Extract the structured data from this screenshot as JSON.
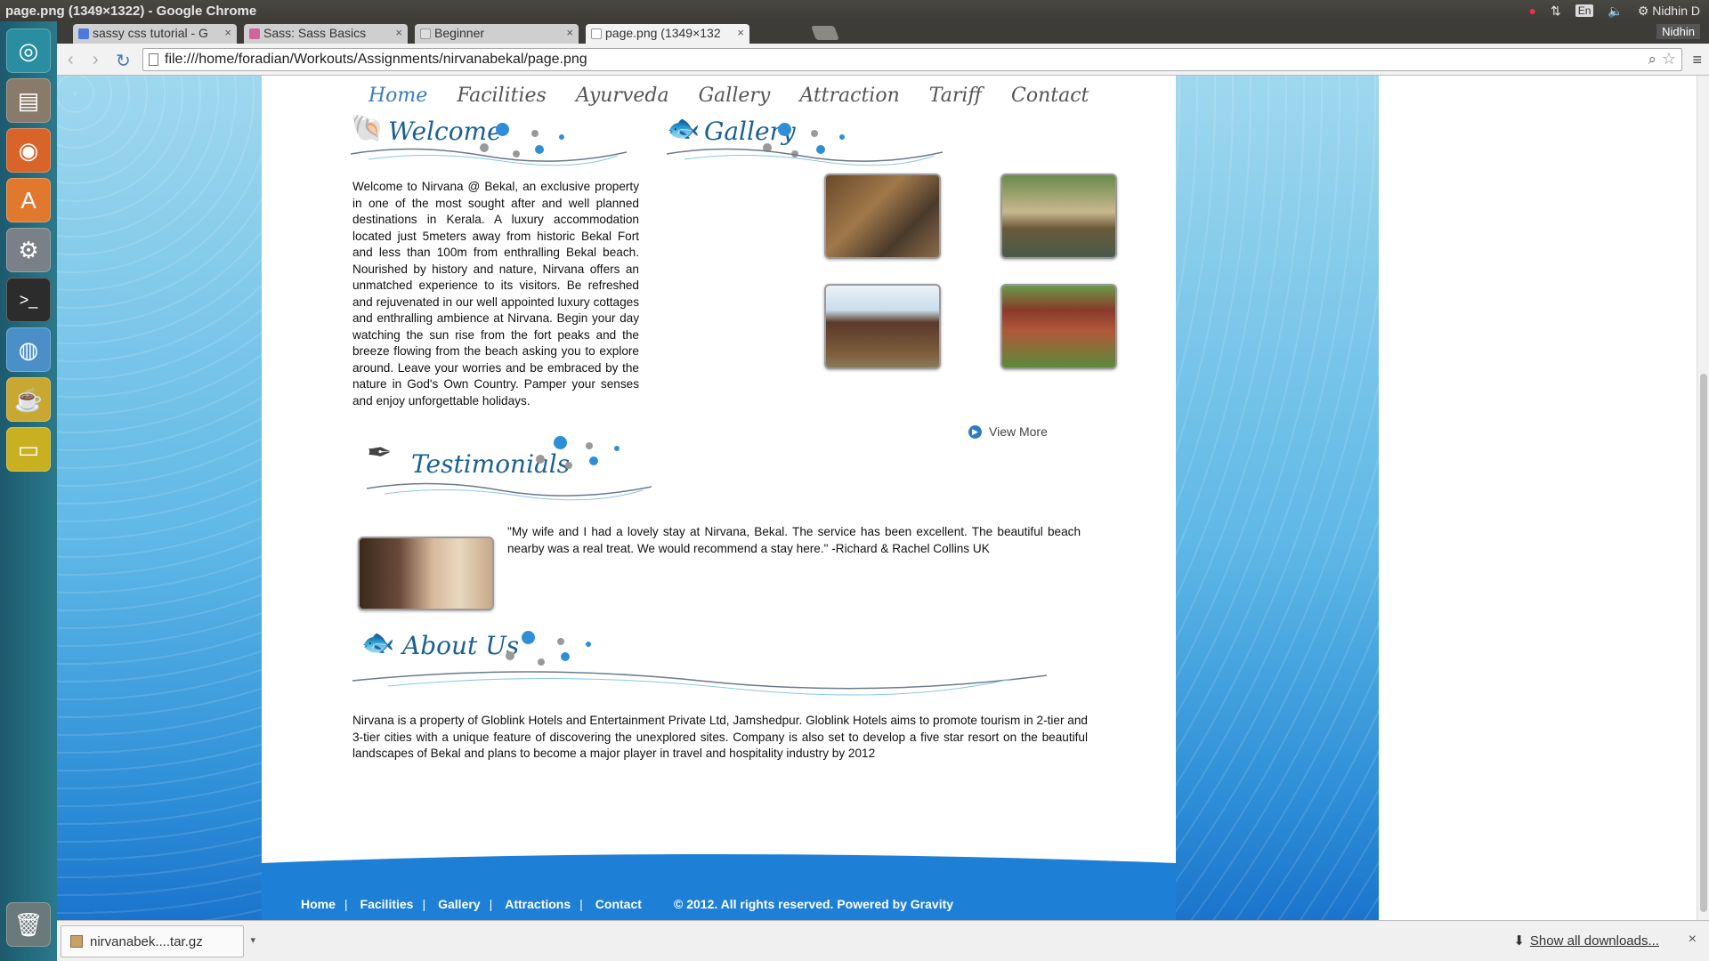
{
  "os": {
    "window_title": "page.png (1349×1322) - Google Chrome",
    "lang": "En",
    "user": "Nidhin D"
  },
  "chrome": {
    "tabs": [
      {
        "label": "sassy css tutorial - G",
        "icon": "google-icon"
      },
      {
        "label": "Sass: Sass Basics",
        "icon": "sass-icon"
      },
      {
        "label": "Beginner",
        "icon": "page-icon"
      },
      {
        "label": "page.png (1349×132",
        "icon": "page-icon"
      }
    ],
    "profile": "Nidhin",
    "url": "file:///home/foradian/Workouts/Assignments/nirvanabekal/page.png"
  },
  "site": {
    "nav": [
      "Home",
      "Facilities",
      "Ayurveda",
      "Gallery",
      "Attraction",
      "Tariff",
      "Contact"
    ],
    "welcome": {
      "title": "Welcome",
      "body": "Welcome to Nirvana @ Bekal, an exclusive property in one of the most sought after and well planned destinations in Kerala. A luxury accommodation located just 5meters away from historic Bekal Fort and less than 100m from enthralling Bekal beach. Nourished by history and nature, Nirvana offers an unmatched experience to its visitors. Be refreshed and rejuvenated in our well appointed luxury cottages and enthralling ambience at Nirvana. Begin your day watching the sun rise from the fort peaks and the breeze flowing from the beach asking you to explore around. Leave your worries and be embraced by the nature in God's Own Country. Pamper your senses and enjoy unforgettable holidays."
    },
    "gallery": {
      "title": "Gallery",
      "view_more": "View More"
    },
    "testimonials": {
      "title": "Testimonials",
      "quote": "\"My wife and I had a lovely stay at Nirvana, Bekal. The service has been excellent. The beautiful beach nearby was a real treat. We would recommend a stay here.\" -Richard & Rachel Collins UK"
    },
    "about": {
      "title": "About Us",
      "body": "Nirvana is a property of Globlink Hotels and Entertainment Private Ltd, Jamshedpur. Globlink Hotels aims to promote tourism in 2-tier and 3-tier cities with a unique feature of discovering the unexplored sites. Company is also set to develop a five star resort on the beautiful landscapes of Bekal and plans to become a major player in travel and hospitality industry by 2012"
    },
    "footer": {
      "links": [
        "Home",
        "Facilities",
        "Gallery",
        "Attractions",
        "Contact"
      ],
      "copyright": "© 2012. All rights reserved. Powered by Gravity"
    }
  },
  "downloads": {
    "file": "nirvanabek....tar.gz",
    "show_all": "Show all downloads..."
  }
}
